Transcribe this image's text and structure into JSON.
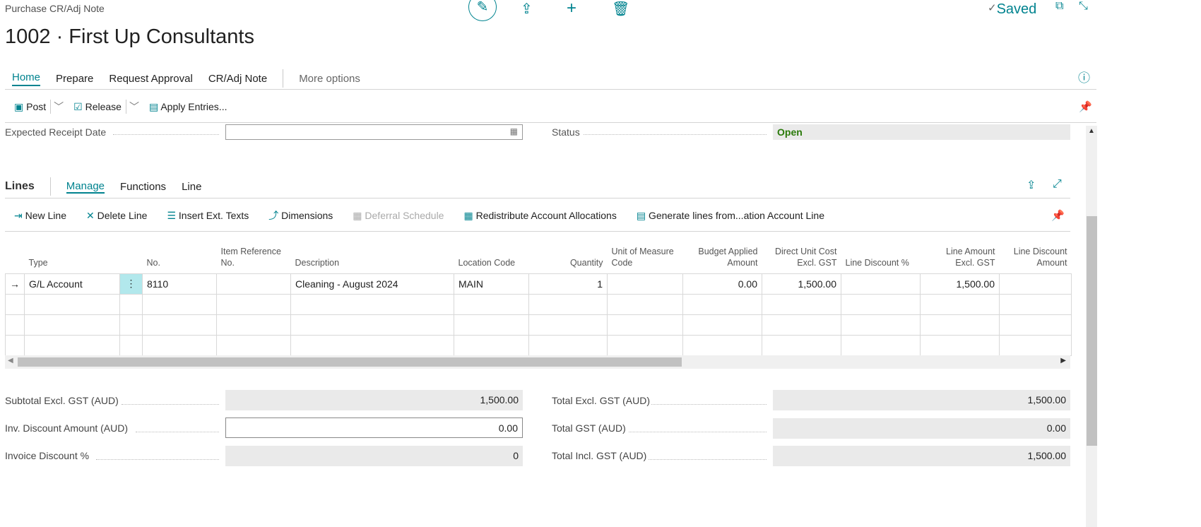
{
  "header": {
    "breadcrumb": "Purchase CR/Adj Note",
    "title": "1002 · First Up Consultants",
    "saved": "Saved"
  },
  "tabs": [
    {
      "label": "Home"
    },
    {
      "label": "Prepare"
    },
    {
      "label": "Request Approval"
    },
    {
      "label": "CR/Adj Note"
    }
  ],
  "more_options": "More options",
  "actions": {
    "post": "Post",
    "release": "Release",
    "apply": "Apply Entries..."
  },
  "general": {
    "expected_receipt_label": "Expected Receipt Date",
    "status_label": "Status",
    "status_value": "Open"
  },
  "lines": {
    "title": "Lines",
    "tabs": [
      "Manage",
      "Functions",
      "Line"
    ],
    "actions": [
      "New Line",
      "Delete Line",
      "Insert Ext. Texts",
      "Dimensions",
      "Deferral Schedule",
      "Redistribute Account Allocations",
      "Generate lines from...ation Account Line"
    ],
    "columns": [
      "Type",
      "No.",
      "Item Reference No.",
      "Description",
      "Location Code",
      "Quantity",
      "Unit of Measure Code",
      "Budget Applied Amount",
      "Direct Unit Cost Excl. GST",
      "Line Discount %",
      "Line Amount Excl. GST",
      "Line Discount Amount"
    ],
    "rows": [
      {
        "type": "G/L Account",
        "no": "8110",
        "item_ref": "",
        "description": "Cleaning - August 2024",
        "location": "MAIN",
        "quantity": "1",
        "uom": "",
        "budget": "0.00",
        "unit_cost": "1,500.00",
        "disc_pct": "",
        "line_amount": "1,500.00",
        "disc_amount": ""
      }
    ]
  },
  "totals": {
    "subtotal_label": "Subtotal Excl. GST (AUD)",
    "subtotal": "1,500.00",
    "inv_disc_label": "Inv. Discount Amount (AUD)",
    "inv_disc": "0.00",
    "inv_disc_pct_label": "Invoice Discount %",
    "inv_disc_pct": "0",
    "total_excl_label": "Total Excl. GST (AUD)",
    "total_excl": "1,500.00",
    "total_gst_label": "Total GST (AUD)",
    "total_gst": "0.00",
    "total_incl_label": "Total Incl. GST (AUD)",
    "total_incl": "1,500.00"
  }
}
